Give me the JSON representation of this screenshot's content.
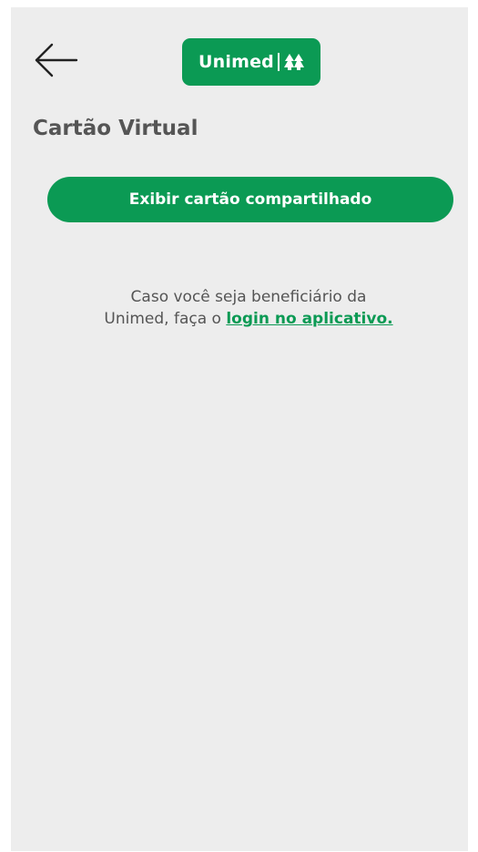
{
  "header": {
    "back_icon": "arrow-left-icon",
    "logo": {
      "text": "Unimed",
      "mark_icon": "unimed-tree-icon",
      "background": "#0b9a54"
    }
  },
  "page": {
    "title": "Cartão Virtual"
  },
  "actions": {
    "show_shared_card_label": "Exibir cartão compartilhado"
  },
  "info": {
    "line1": "Caso você seja beneficiário da",
    "line2_prefix": "Unimed, faça o",
    "login_link_label": "login no aplicativo."
  },
  "colors": {
    "brand_green": "#0b9a54",
    "background": "#ededed",
    "text_gray": "#555555"
  }
}
